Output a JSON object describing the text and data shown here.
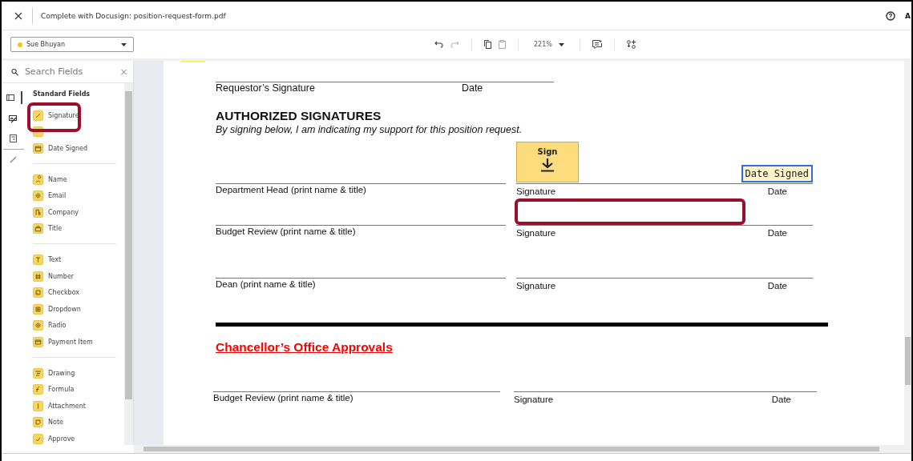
{
  "window": {
    "title": "Complete with Docusign: position-request-form.pdf",
    "account_initial": "A"
  },
  "recipient": {
    "name": "Sue Bhuyan",
    "color": "#f5c518"
  },
  "toolbar": {
    "zoom": "221%"
  },
  "search": {
    "placeholder": "Search Fields"
  },
  "sidebar": {
    "heading": "Standard Fields",
    "groups": [
      [
        {
          "kind": "signature",
          "label": "Signature"
        },
        {
          "kind": "initial"
        },
        {
          "kind": "date",
          "label": "Date Signed"
        }
      ],
      [
        {
          "kind": "name",
          "label": "Name"
        },
        {
          "kind": "email",
          "label": "Email"
        },
        {
          "kind": "company",
          "label": "Company"
        },
        {
          "kind": "title",
          "label": "Title"
        }
      ],
      [
        {
          "kind": "text",
          "label": "Text"
        },
        {
          "kind": "number",
          "label": "Number"
        },
        {
          "kind": "checkbox",
          "label": "Checkbox"
        },
        {
          "kind": "dropdown",
          "label": "Dropdown"
        },
        {
          "kind": "radio",
          "label": "Radio"
        },
        {
          "kind": "payment",
          "label": "Payment Item"
        }
      ],
      [
        {
          "kind": "drawing",
          "label": "Drawing"
        },
        {
          "kind": "formula",
          "label": "Formula"
        },
        {
          "kind": "attachment",
          "label": "Attachment"
        },
        {
          "kind": "note",
          "label": "Note"
        },
        {
          "kind": "approve",
          "label": "Approve"
        }
      ]
    ]
  },
  "document": {
    "requestor": {
      "signature_label": "Requestor’s Signature",
      "date_label": "Date"
    },
    "heading": "AUTHORIZED SIGNATURES",
    "instruction": "By signing below, I am indicating my support for this position request.",
    "rows": [
      {
        "name_label": "Department Head (print name & title)",
        "signature_label": "Signature",
        "date_label": "Date",
        "sign_tag": "Sign",
        "date_field": "Date Signed"
      },
      {
        "name_label": "Budget Review (print name & title)",
        "signature_label": "Signature",
        "date_label": "Date"
      },
      {
        "name_label": "Dean (print name & title)",
        "signature_label": "Signature",
        "date_label": "Date"
      }
    ],
    "section_title": "Chancellor’s Office Approvals",
    "section_rows": [
      {
        "name_label": "Budget Review (print name & title)",
        "signature_label": "Signature",
        "date_label": "Date"
      }
    ]
  }
}
